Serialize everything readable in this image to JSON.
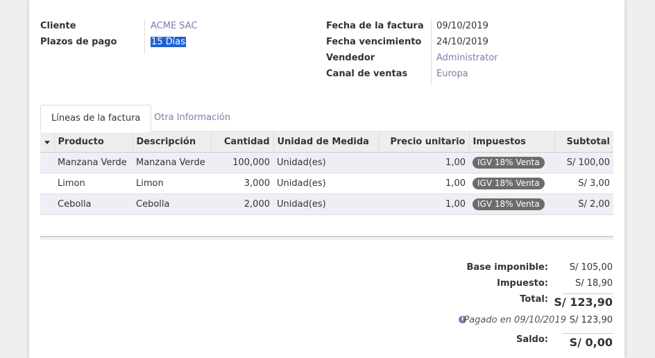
{
  "form": {
    "cliente_label": "Cliente",
    "cliente_value": "ACME SAC",
    "plazos_label": "Plazos de pago",
    "plazos_value": "15 Días",
    "fecha_factura_label": "Fecha de la factura",
    "fecha_factura_value": "09/10/2019",
    "fecha_venc_label": "Fecha vencimiento",
    "fecha_venc_value": "24/10/2019",
    "vendedor_label": "Vendedor",
    "vendedor_value": "Administrator",
    "canal_label": "Canal de ventas",
    "canal_value": "Europa"
  },
  "tabs": [
    {
      "label": "Líneas de la factura"
    },
    {
      "label": "Otra Información"
    }
  ],
  "table": {
    "columns": [
      "Producto",
      "Descripción",
      "Cantidad",
      "Unidad de Medida",
      "Precio unitario",
      "Impuestos",
      "Subtotal"
    ],
    "rows": [
      {
        "producto": "Manzana Verde",
        "descripcion": "Manzana Verde",
        "cantidad": "100,000",
        "unidad": "Unidad(es)",
        "precio": "1,00",
        "impuesto": "IGV 18% Venta",
        "subtotal": "S/ 100,00"
      },
      {
        "producto": "Limon",
        "descripcion": "Limon",
        "cantidad": "3,000",
        "unidad": "Unidad(es)",
        "precio": "1,00",
        "impuesto": "IGV 18% Venta",
        "subtotal": "S/ 3,00"
      },
      {
        "producto": "Cebolla",
        "descripcion": "Cebolla",
        "cantidad": "2,000",
        "unidad": "Unidad(es)",
        "precio": "1,00",
        "impuesto": "IGV 18% Venta",
        "subtotal": "S/ 2,00"
      }
    ]
  },
  "totals": {
    "base_label": "Base imponible:",
    "base_value": "S/ 105,00",
    "impuesto_label": "Impuesto:",
    "impuesto_value": "S/ 18,90",
    "total_label": "Total:",
    "total_value": "S/ 123,90",
    "pagado_label": "Pagado en 09/10/2019",
    "pagado_value": "S/ 123,90",
    "saldo_label": "Saldo:",
    "saldo_value": "S/ 0,00"
  },
  "icons": {
    "info": "info-icon",
    "caret": "caret-down-icon"
  }
}
